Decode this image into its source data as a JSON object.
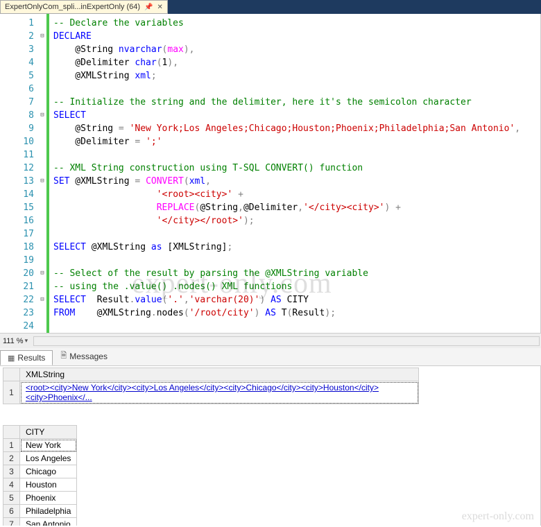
{
  "tab": {
    "label": "ExpertOnlyCom_spli...inExpertOnly (64)",
    "pin_icon": "pin-icon",
    "close_icon": "close-icon"
  },
  "editor": {
    "line_count": 24,
    "lines": [
      {
        "n": 1,
        "html": "<span class='cm'>-- Declare the variables</span>"
      },
      {
        "n": 2,
        "html": "<span class='kw'>DECLARE</span>"
      },
      {
        "n": 3,
        "html": "    @String <span class='kw'>nvarchar</span><span class='op'>(</span><span class='fn'>max</span><span class='op'>),</span>"
      },
      {
        "n": 4,
        "html": "    @Delimiter <span class='kw'>char</span><span class='op'>(</span>1<span class='op'>),</span>"
      },
      {
        "n": 5,
        "html": "    @XMLString <span class='kw'>xml</span><span class='op'>;</span>"
      },
      {
        "n": 6,
        "html": ""
      },
      {
        "n": 7,
        "html": "<span class='cm'>-- Initialize the string and the delimiter, here it's the semicolon character</span>"
      },
      {
        "n": 8,
        "html": "<span class='kw'>SELECT</span>"
      },
      {
        "n": 9,
        "html": "    @String <span class='op'>=</span> <span class='str'>'New York;Los Angeles;Chicago;Houston;Phoenix;Philadelphia;San Antonio'</span><span class='op'>,</span>"
      },
      {
        "n": 10,
        "html": "    @Delimiter <span class='op'>=</span> <span class='str'>';'</span>"
      },
      {
        "n": 11,
        "html": ""
      },
      {
        "n": 12,
        "html": "<span class='cm'>-- XML String construction using T-SQL CONVERT() function</span>"
      },
      {
        "n": 13,
        "html": "<span class='kw'>SET</span> @XMLString <span class='op'>=</span> <span class='fn'>CONVERT</span><span class='op'>(</span><span class='kw'>xml</span><span class='op'>,</span>"
      },
      {
        "n": 14,
        "html": "                   <span class='str'>'&lt;root&gt;&lt;city&gt;'</span> <span class='op'>+</span>"
      },
      {
        "n": 15,
        "html": "                   <span class='fn'>REPLACE</span><span class='op'>(</span>@String<span class='op'>,</span>@Delimiter<span class='op'>,</span><span class='str'>'&lt;/city&gt;&lt;city&gt;'</span><span class='op'>)</span> <span class='op'>+</span>"
      },
      {
        "n": 16,
        "html": "                   <span class='str'>'&lt;/city&gt;&lt;/root&gt;'</span><span class='op'>);</span>"
      },
      {
        "n": 17,
        "html": ""
      },
      {
        "n": 18,
        "html": "<span class='kw'>SELECT</span> @XMLString <span class='kw'>as</span> [XMLString]<span class='op'>;</span>"
      },
      {
        "n": 19,
        "html": ""
      },
      {
        "n": 20,
        "html": "<span class='cm'>-- Select of the result by parsing the @XMLString variable</span>"
      },
      {
        "n": 21,
        "html": "<span class='cm'>-- using the .value() .nodes() XML functions</span>"
      },
      {
        "n": 22,
        "html": "<span class='kw'>SELECT</span>  Result<span class='op'>.</span><span class='kw'>value</span><span class='op'>(</span><span class='str'>'.'</span><span class='op'>,</span><span class='str'>'varchar(20)'</span><span class='op'>)</span> <span class='kw'>AS</span> CITY"
      },
      {
        "n": 23,
        "html": "<span class='kw'>FROM</span>    @XMLString<span class='op'>.</span>nodes<span class='op'>(</span><span class='str'>'/root/city'</span><span class='op'>)</span> <span class='kw'>AS</span> T<span class='op'>(</span>Result<span class='op'>);</span>"
      },
      {
        "n": 24,
        "html": ""
      }
    ],
    "fold_markers": {
      "2": "⊟",
      "8": "⊟",
      "13": "⊟",
      "20": "⊟",
      "22": "⊟"
    }
  },
  "watermark_main": "expert-only.com",
  "watermark_small": "expert-only.com",
  "status": {
    "zoom": "111 %"
  },
  "result_tabs": {
    "results_label": "Results",
    "messages_label": "Messages"
  },
  "grid1": {
    "header": "XMLString",
    "row_num": "1",
    "cell": "<root><city>New York</city><city>Los Angeles</city><city>Chicago</city><city>Houston</city><city>Phoenix</..."
  },
  "grid2": {
    "header": "CITY",
    "rows": [
      {
        "n": "1",
        "v": "New York"
      },
      {
        "n": "2",
        "v": "Los Angeles"
      },
      {
        "n": "3",
        "v": "Chicago"
      },
      {
        "n": "4",
        "v": "Houston"
      },
      {
        "n": "5",
        "v": "Phoenix"
      },
      {
        "n": "6",
        "v": "Philadelphia"
      },
      {
        "n": "7",
        "v": "San Antonio"
      }
    ]
  }
}
